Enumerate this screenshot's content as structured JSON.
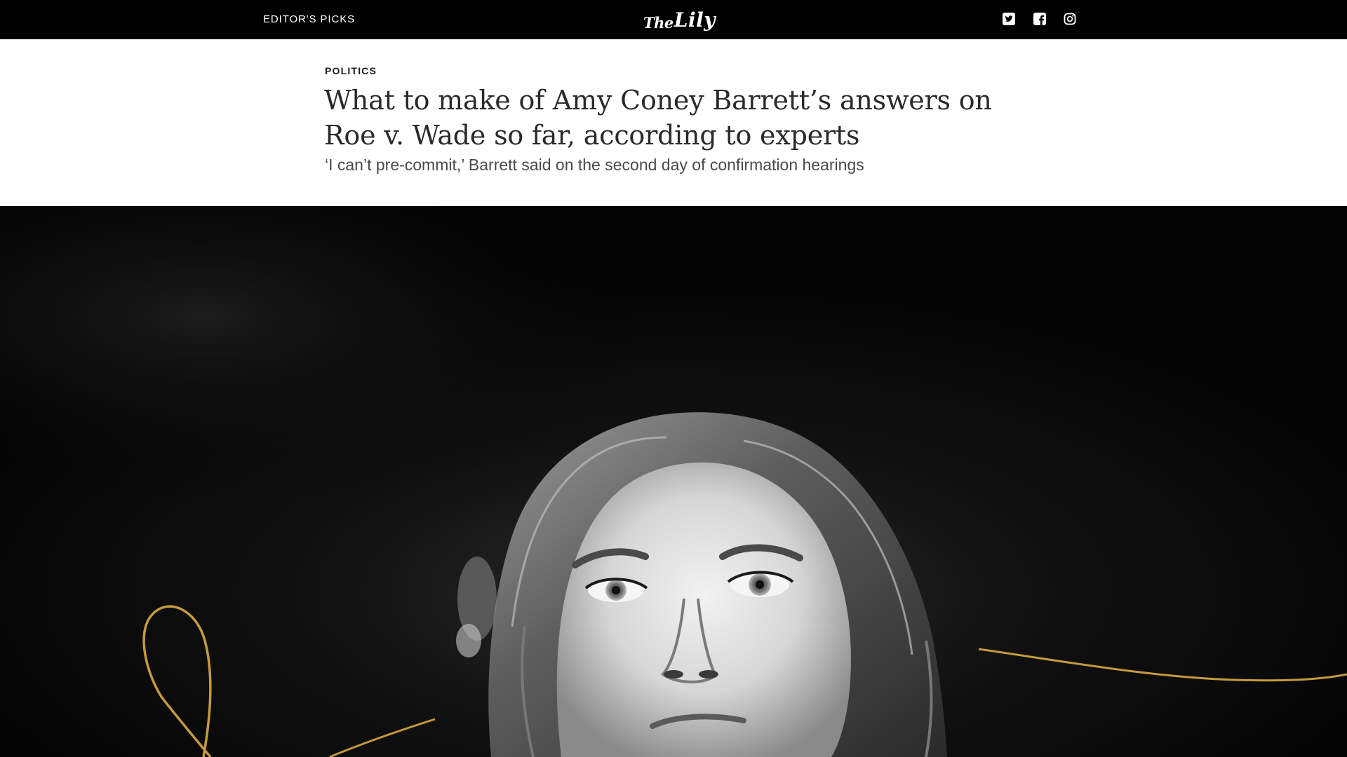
{
  "topbar": {
    "nav_label": "EDITOR'S PICKS",
    "logo": {
      "the": "The",
      "lily": "Lily"
    },
    "social": [
      {
        "name": "twitter",
        "icon": "twitter-icon"
      },
      {
        "name": "facebook",
        "icon": "facebook-icon"
      },
      {
        "name": "instagram",
        "icon": "instagram-icon"
      }
    ]
  },
  "article": {
    "kicker": "POLITICS",
    "headline": "What to make of Amy Coney Barrett’s answers on Roe v. Wade so far, according to experts",
    "dek": "‘I can’t pre-commit,’ Barrett said on the second day of confirmation hearings"
  },
  "colors": {
    "topbar_bg": "#000000",
    "hero_bg": "#030303",
    "accent_gold": "#c49a3c",
    "headline": "#2a2a2a"
  }
}
